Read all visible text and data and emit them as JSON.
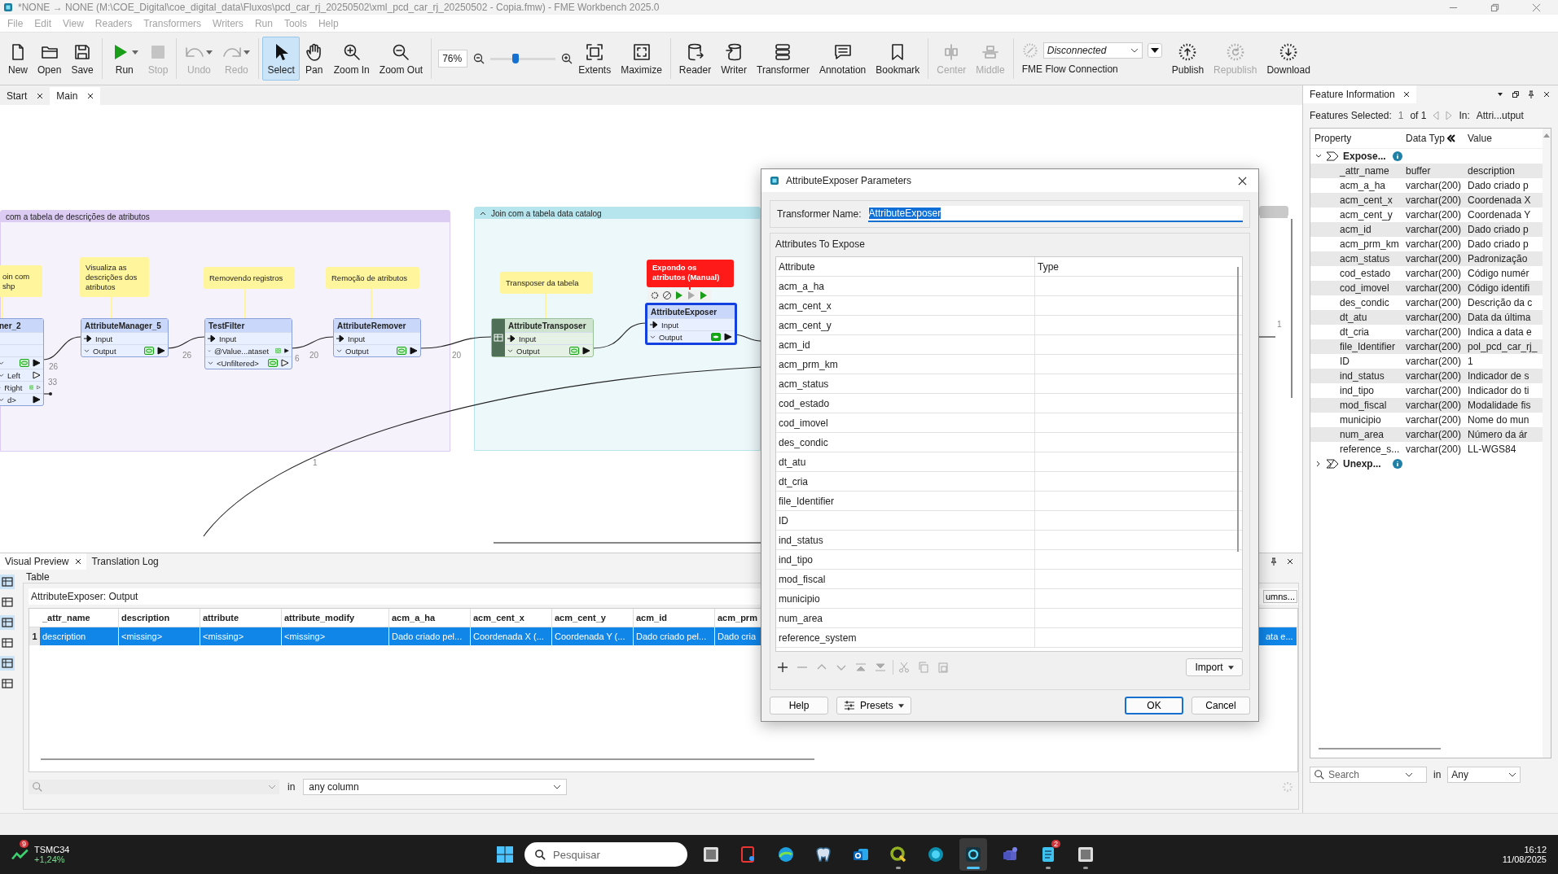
{
  "window": {
    "title": "*NONE → NONE (M:\\COE_Digital\\coe_digital_data\\Fluxos\\pcd_car_rj_20250502\\xml_pcd_car_rj_20250502 - Copia.fmw) - FME Workbench 2025.0"
  },
  "menu": [
    "File",
    "Edit",
    "View",
    "Readers",
    "Transformers",
    "Writers",
    "Run",
    "Tools",
    "Help"
  ],
  "toolbar": {
    "sections": [
      {
        "kind": "tools",
        "tools": [
          {
            "label": "New",
            "selected": false,
            "disabled": false,
            "dropdown": false
          },
          {
            "label": "Open",
            "selected": false,
            "disabled": false,
            "dropdown": false
          },
          {
            "label": "Save",
            "selected": false,
            "disabled": false,
            "dropdown": false
          }
        ]
      },
      {
        "kind": "tools",
        "tools": [
          {
            "label": "Run",
            "selected": false,
            "disabled": false,
            "dropdown": true
          },
          {
            "label": "Stop",
            "selected": false,
            "disabled": true,
            "dropdown": false
          }
        ]
      },
      {
        "kind": "tools",
        "tools": [
          {
            "label": "Undo",
            "selected": false,
            "disabled": true,
            "dropdown": true
          },
          {
            "label": "Redo",
            "selected": false,
            "disabled": true,
            "dropdown": true
          }
        ]
      },
      {
        "kind": "tools",
        "tools": [
          {
            "label": "Select",
            "selected": true,
            "disabled": false,
            "dropdown": false
          },
          {
            "label": "Pan",
            "selected": false,
            "disabled": false,
            "dropdown": false
          },
          {
            "label": "Zoom In",
            "selected": false,
            "disabled": false,
            "dropdown": false
          },
          {
            "label": "Zoom Out",
            "selected": false,
            "disabled": false,
            "dropdown": false
          }
        ]
      },
      {
        "kind": "zoom",
        "value": "76%",
        "level": 0.38,
        "tools": [
          {
            "label": "Extents",
            "selected": false,
            "disabled": false,
            "dropdown": false
          },
          {
            "label": "Maximize",
            "selected": false,
            "disabled": false,
            "dropdown": false
          }
        ]
      },
      {
        "kind": "tools",
        "tools": [
          {
            "label": "Reader",
            "selected": false,
            "disabled": false,
            "dropdown": false
          },
          {
            "label": "Writer",
            "selected": false,
            "disabled": false,
            "dropdown": false
          },
          {
            "label": "Transformer",
            "selected": false,
            "disabled": false,
            "dropdown": false
          },
          {
            "label": "Annotation",
            "selected": false,
            "disabled": false,
            "dropdown": false
          },
          {
            "label": "Bookmark",
            "selected": false,
            "disabled": false,
            "dropdown": false
          }
        ]
      },
      {
        "kind": "tools",
        "tools": [
          {
            "label": "Center",
            "selected": false,
            "disabled": true,
            "dropdown": false
          },
          {
            "label": "Middle",
            "selected": false,
            "disabled": true,
            "dropdown": false
          }
        ]
      },
      {
        "kind": "flow",
        "value": "Disconnected",
        "label": "FME Flow Connection",
        "tools": [
          {
            "label": "Publish",
            "selected": false,
            "disabled": false,
            "dropdown": false
          },
          {
            "label": "Republish",
            "selected": false,
            "disabled": true,
            "dropdown": false
          },
          {
            "label": "Download",
            "selected": false,
            "disabled": false,
            "dropdown": false
          }
        ]
      }
    ]
  },
  "doc_tabs": [
    {
      "label": "Start",
      "selected": false
    },
    {
      "label": "Main",
      "selected": true
    }
  ],
  "canvas": {
    "bookmarks": [
      {
        "title": "com  a tabela de descrições de atributos",
        "collapsible": false,
        "color": "#dccbf2"
      },
      {
        "title": "Join com a tabela data catalog",
        "collapsible": true,
        "color": "#b7e5ee"
      },
      {
        "collapsible": false,
        "color": "#c9c9c9"
      }
    ],
    "annotations": [
      {
        "text": "oin com shp",
        "color": "#fff59d"
      },
      {
        "text": "Visualiza as descrições dos atributos",
        "color": "#fff59d"
      },
      {
        "text": "Removendo registros",
        "color": "#fff59d"
      },
      {
        "text": "Remoção de  atributos",
        "color": "#fff59d"
      },
      {
        "text": "Transposer da tabela",
        "color": "#fff59d"
      },
      {
        "text": "Expondo os atributos (Manual)",
        "color": "#ff1a1a"
      }
    ],
    "transformers": [
      {
        "name": "ner_2",
        "kind": "standard",
        "selected": false,
        "ports": [
          {
            "kind": "blank"
          },
          {
            "kind": "blank"
          },
          {
            "kind": "output",
            "inspect": true,
            "connected": true
          },
          {
            "label": "Left",
            "kind": "output",
            "inspect": false,
            "connected": false
          },
          {
            "label": "Right",
            "kind": "output",
            "inspect": true,
            "connected": false
          },
          {
            "label": "d>",
            "kind": "output",
            "inspect": false,
            "connected": true
          }
        ]
      },
      {
        "name": "AttributeManager_5",
        "kind": "standard",
        "selected": false,
        "ports": [
          {
            "label": "Input",
            "kind": "input",
            "inspect": false,
            "connected": true
          },
          {
            "label": "Output",
            "kind": "output",
            "inspect": true,
            "connected": true
          }
        ]
      },
      {
        "name": "TestFilter",
        "kind": "standard",
        "selected": false,
        "ports": [
          {
            "label": "Input",
            "kind": "input",
            "inspect": false,
            "connected": true
          },
          {
            "label": "@Value...ataset",
            "kind": "output",
            "inspect": true,
            "connected": true
          },
          {
            "label": "<Unfiltered>",
            "kind": "output",
            "inspect": true,
            "connected": false
          }
        ]
      },
      {
        "name": "AttributeRemover",
        "kind": "standard",
        "selected": false,
        "ports": [
          {
            "label": "Input",
            "kind": "input",
            "inspect": false,
            "connected": true
          },
          {
            "label": "Output",
            "kind": "output",
            "inspect": true,
            "connected": true
          }
        ]
      },
      {
        "name": "AttributeTransposer",
        "kind": "custom",
        "selected": false,
        "ports": [
          {
            "label": "Input",
            "kind": "input",
            "inspect": false,
            "connected": true
          },
          {
            "label": "Output",
            "kind": "output",
            "inspect": true,
            "connected": true
          }
        ]
      },
      {
        "name": "AttributeExposer",
        "kind": "standard",
        "selected": true,
        "ports": [
          {
            "label": "Input",
            "kind": "input",
            "inspect": false,
            "connected": true
          },
          {
            "label": "Output",
            "kind": "output",
            "inspect": true,
            "connected": true
          }
        ]
      }
    ],
    "counts": [
      "26",
      "26",
      "20",
      "6",
      "33",
      "20",
      "1",
      "1"
    ]
  },
  "preview": {
    "tabs": [
      {
        "label": "Visual Preview",
        "selected": true
      },
      {
        "label": "Translation Log",
        "selected": false
      }
    ],
    "group": "Table",
    "source": "AttributeExposer: Output",
    "columns_button": "umns...",
    "columns": [
      "_attr_name",
      "description",
      "attribute",
      "attribute_modify",
      "acm_a_ha",
      "acm_cent_x",
      "acm_cent_y",
      "acm_id",
      "acm_prm"
    ],
    "rows": [
      {
        "number": "1",
        "selected": true,
        "cells": [
          "description",
          "<missing>",
          "<missing>",
          "<missing>",
          "Dado criado pel...",
          "Coordenada X (...",
          "Coordenada Y (...",
          "Dado criado pel...",
          "Dado cria"
        ],
        "tail_cell": "ata e..."
      }
    ],
    "search_in": "in",
    "scope": "any column"
  },
  "feature_info": {
    "title": "Feature Information",
    "selected_label": "Features Selected:",
    "index": "1",
    "of": "of 1",
    "in_label": "In:",
    "in_value": "Attri...utput",
    "columns": [
      "Property",
      "Data Typ",
      "Value"
    ],
    "groups": [
      {
        "label": "Expose...",
        "expanded": true,
        "children": [
          {
            "property": "_attr_name",
            "type": "buffer",
            "value": "description"
          },
          {
            "property": "acm_a_ha",
            "type": "varchar(200)",
            "value": "Dado criado p"
          },
          {
            "property": "acm_cent_x",
            "type": "varchar(200)",
            "value": "Coordenada X"
          },
          {
            "property": "acm_cent_y",
            "type": "varchar(200)",
            "value": "Coordenada Y"
          },
          {
            "property": "acm_id",
            "type": "varchar(200)",
            "value": "Dado criado p"
          },
          {
            "property": "acm_prm_km",
            "type": "varchar(200)",
            "value": "Dado criado p"
          },
          {
            "property": "acm_status",
            "type": "varchar(200)",
            "value": "Padronização"
          },
          {
            "property": "cod_estado",
            "type": "varchar(200)",
            "value": "Código numér"
          },
          {
            "property": "cod_imovel",
            "type": "varchar(200)",
            "value": "Código identifi"
          },
          {
            "property": "des_condic",
            "type": "varchar(200)",
            "value": "Descrição da c"
          },
          {
            "property": "dt_atu",
            "type": "varchar(200)",
            "value": "Data da última"
          },
          {
            "property": "dt_cria",
            "type": "varchar(200)",
            "value": "Indica a data e"
          },
          {
            "property": "file_Identifier",
            "type": "varchar(200)",
            "value": "pol_pcd_car_rj_"
          },
          {
            "property": "ID",
            "type": "varchar(200)",
            "value": "1"
          },
          {
            "property": "ind_status",
            "type": "varchar(200)",
            "value": "Indicador de s"
          },
          {
            "property": "ind_tipo",
            "type": "varchar(200)",
            "value": "Indicador do ti"
          },
          {
            "property": "mod_fiscal",
            "type": "varchar(200)",
            "value": "Modalidade fis"
          },
          {
            "property": "municipio",
            "type": "varchar(200)",
            "value": "Nome do mun"
          },
          {
            "property": "num_area",
            "type": "varchar(200)",
            "value": "Número da ár"
          },
          {
            "property": "reference_s...",
            "type": "varchar(200)",
            "value": "LL-WGS84"
          }
        ]
      },
      {
        "label": "Unexp...",
        "expanded": false
      }
    ],
    "search": {
      "placeholder": "Search"
    },
    "search_in": "in",
    "scope": "Any"
  },
  "dialog": {
    "title": "AttributeExposer Parameters",
    "name_label": "Transformer Name:",
    "name_value": "AttributeExposer",
    "name_selected": true,
    "group": "Attributes To Expose",
    "columns": [
      "Attribute",
      "Type"
    ],
    "attributes": [
      "acm_a_ha",
      "acm_cent_x",
      "acm_cent_y",
      "acm_id",
      "acm_prm_km",
      "acm_status",
      "cod_estado",
      "cod_imovel",
      "des_condic",
      "dt_atu",
      "dt_cria",
      "file_Identifier",
      "ID",
      "ind_status",
      "ind_tipo",
      "mod_fiscal",
      "municipio",
      "num_area",
      "reference_system"
    ],
    "import": "Import",
    "help": "Help",
    "presets": "Presets",
    "ok": "OK",
    "cancel": "Cancel"
  },
  "taskbar": {
    "widget": {
      "name": "TSMC34",
      "change": "+1,24%",
      "badge": "9"
    },
    "search": {
      "placeholder": "Pesquisar"
    },
    "apps": [
      {
        "running": false,
        "selected": false
      },
      {
        "running": false,
        "selected": false
      },
      {
        "running": false,
        "selected": false
      },
      {
        "running": false,
        "selected": false
      },
      {
        "running": false,
        "selected": false
      },
      {
        "running": true,
        "selected": false
      },
      {
        "running": false,
        "selected": false
      },
      {
        "running": true,
        "selected": true
      },
      {
        "running": false,
        "selected": false
      },
      {
        "running": true,
        "selected": false,
        "badge": "2"
      },
      {
        "running": true,
        "selected": false
      }
    ],
    "clock": {
      "time": "16:12",
      "date": "11/08/2025"
    }
  }
}
